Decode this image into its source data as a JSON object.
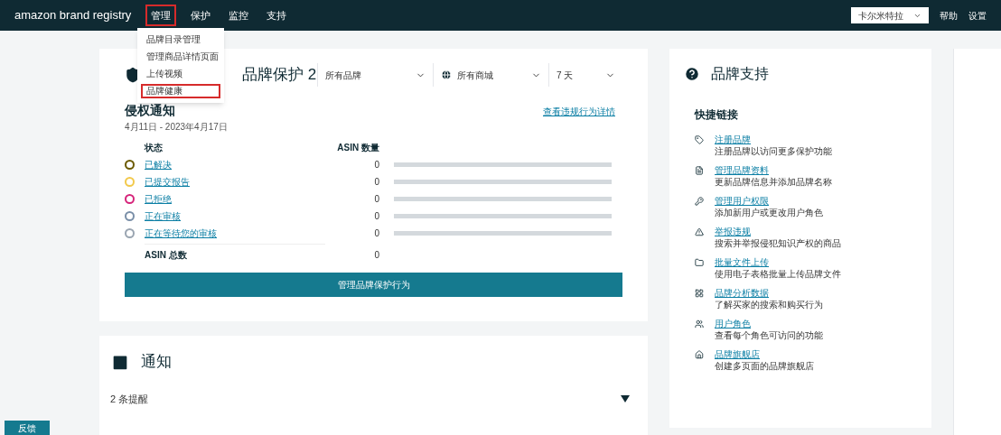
{
  "header": {
    "logo": "amazon brand registry",
    "nav": [
      {
        "label": "管理",
        "selected": true
      },
      {
        "label": "保护",
        "selected": false
      },
      {
        "label": "监控",
        "selected": false
      },
      {
        "label": "支持",
        "selected": false
      }
    ],
    "account": "卡尔米特拉",
    "links": [
      "帮助",
      "设置"
    ]
  },
  "menu": {
    "items": [
      {
        "label": "品牌目录管理",
        "selected": false
      },
      {
        "label": "管理商品详情页面",
        "selected": false
      },
      {
        "label": "上传视频",
        "selected": false
      },
      {
        "label": "品牌健康",
        "selected": true
      }
    ]
  },
  "protection": {
    "title": "品牌保护 2",
    "filters": [
      {
        "label": "所有品牌",
        "kind": "plain"
      },
      {
        "label": "所有商城",
        "kind": "globe"
      },
      {
        "label": "7 天",
        "kind": "plain"
      }
    ],
    "section_title": "侵权通知",
    "date_range": "4月11日 - 2023年4月17日",
    "link": "查看违规行为详情",
    "columns": [
      "状态",
      "ASIN 数量"
    ],
    "rows": [
      {
        "label": "已解决",
        "value": "0",
        "color": "#6b5a00"
      },
      {
        "label": "已提交报告",
        "value": "0",
        "color": "#f2c94c"
      },
      {
        "label": "已拒绝",
        "value": "0",
        "color": "#d6247a"
      },
      {
        "label": "正在审核",
        "value": "0",
        "color": "#7a8fa8"
      },
      {
        "label": "正在等待您的审核",
        "value": "0",
        "color": "#9aa5b1"
      }
    ],
    "total_label": "ASIN 总数",
    "total_value": "0",
    "button": "管理品牌保护行为"
  },
  "notifications": {
    "title": "通知",
    "summary": "2 条提醒",
    "expanded": false
  },
  "support": {
    "title": "品牌支持",
    "subtitle": "快捷链接",
    "items": [
      {
        "kind": "tag",
        "title": "注册品牌",
        "text": "注册品牌以访问更多保护功能"
      },
      {
        "kind": "file",
        "title": "管理品牌资料",
        "text": "更新品牌信息并添加品牌名称"
      },
      {
        "kind": "key",
        "title": "管理用户权限",
        "text": "添加新用户或更改用户角色"
      },
      {
        "kind": "warning",
        "title": "举报违规",
        "text": "搜索并举报侵犯知识产权的商品"
      },
      {
        "kind": "folder",
        "title": "批量文件上传",
        "text": "使用电子表格批量上传品牌文件"
      },
      {
        "kind": "grid",
        "title": "品牌分析数据",
        "text": "了解买家的搜索和购买行为"
      },
      {
        "kind": "people",
        "title": "用户角色",
        "text": "查看每个角色可访问的功能"
      },
      {
        "kind": "home",
        "title": "品牌旗舰店",
        "text": "创建多页面的品牌旗舰店"
      }
    ]
  },
  "feedback": "反馈"
}
